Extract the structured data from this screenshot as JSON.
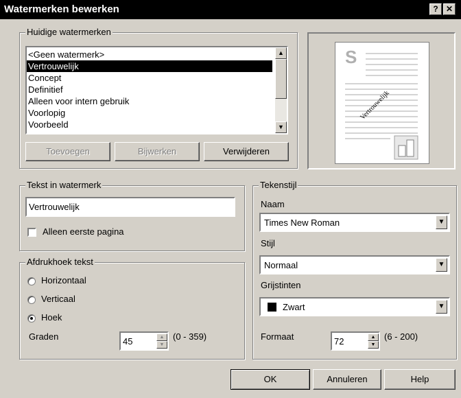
{
  "dialog": {
    "title": "Watermerken bewerken",
    "help_glyph": "?",
    "close_glyph": "✕"
  },
  "current": {
    "legend": "Huidige watermerken",
    "items": [
      "<Geen watermerk>",
      "Vertrouwelijk",
      "Concept",
      "Definitief",
      "Alleen voor intern gebruik",
      "Voorlopig",
      "Voorbeeld"
    ],
    "selected_index": 1,
    "add_label": "Toevoegen",
    "update_label": "Bijwerken",
    "delete_label": "Verwijderen"
  },
  "preview": {
    "logo_letter": "S",
    "watermark_text": "Vertrouwelijk"
  },
  "text": {
    "legend": "Tekst in watermerk",
    "value": "Vertrouwelijk",
    "first_page_label": "Alleen eerste pagina",
    "first_page_checked": false
  },
  "angle": {
    "legend": "Afdrukhoek tekst",
    "options": [
      "Horizontaal",
      "Verticaal",
      "Hoek"
    ],
    "selected": "Hoek",
    "degrees_label": "Graden",
    "degrees_value": "45",
    "degrees_range": "(0 - 359)"
  },
  "font": {
    "legend": "Tekenstijl",
    "name_label": "Naam",
    "name_value": "Times New Roman",
    "style_label": "Stijl",
    "style_value": "Normaal",
    "gray_label": "Grijstinten",
    "gray_value": "Zwart",
    "gray_swatch": "#000000",
    "size_label": "Formaat",
    "size_value": "72",
    "size_range": "(6 - 200)"
  },
  "footer": {
    "ok_label": "OK",
    "cancel_label": "Annuleren",
    "help_label": "Help"
  }
}
